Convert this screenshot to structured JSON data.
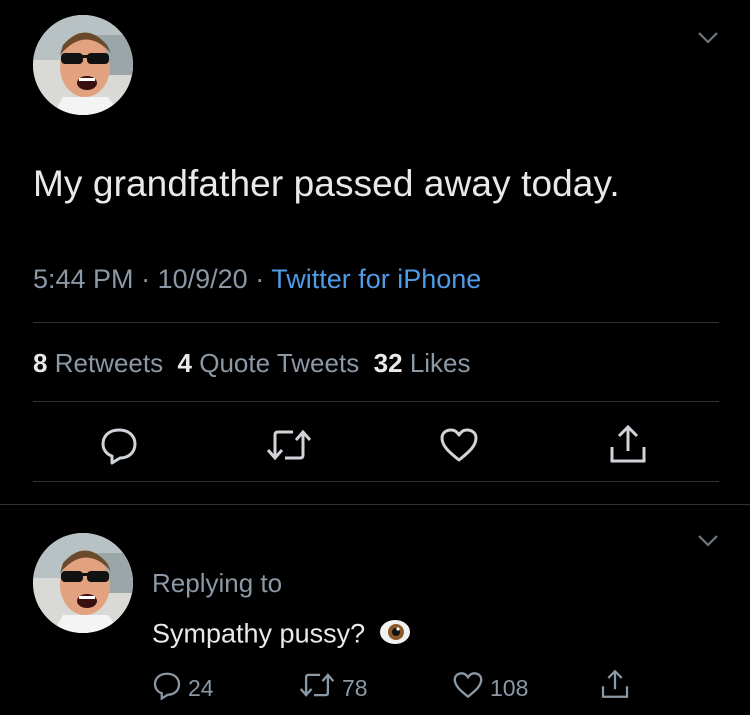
{
  "main_tweet": {
    "text": "My grandfather passed away today.",
    "time": "5:44 PM",
    "date": "10/9/20",
    "separator": "·",
    "source": "Twitter for iPhone",
    "stats": {
      "retweets_count": "8",
      "retweets_label": "Retweets",
      "quote_count": "4",
      "quote_label": "Quote Tweets",
      "likes_count": "32",
      "likes_label": "Likes"
    },
    "actions": [
      "reply-icon",
      "retweet-icon",
      "like-icon",
      "share-icon"
    ]
  },
  "reply": {
    "replying_to_label": "Replying to",
    "text": "Sympathy pussy?",
    "emoji": "👁",
    "reply_count": "24",
    "retweet_count": "78",
    "like_count": "108"
  },
  "colors": {
    "background": "#000000",
    "text": "#e7e9ea",
    "muted": "#8b98a5",
    "link": "#4f9be6",
    "divider": "#2f3336"
  }
}
